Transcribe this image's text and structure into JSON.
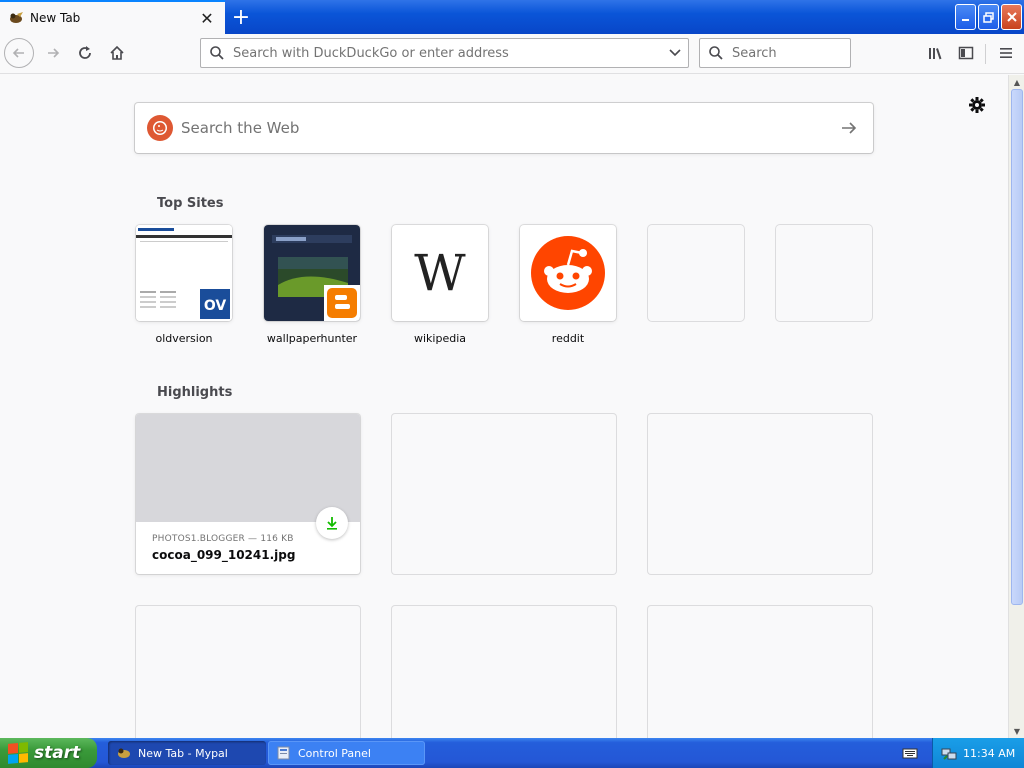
{
  "tab": {
    "title": "New Tab",
    "favicon": "mypal-icon"
  },
  "toolbar": {
    "url_placeholder": "Search with DuckDuckGo or enter address",
    "search_placeholder": "Search"
  },
  "page": {
    "web_search_placeholder": "Search the Web",
    "top_sites_heading": "Top Sites",
    "highlights_heading": "Highlights",
    "top_sites": [
      {
        "label": "oldversion"
      },
      {
        "label": "wallpaperhunter"
      },
      {
        "label": "wikipedia",
        "glyph": "W"
      },
      {
        "label": "reddit"
      },
      {
        "label": ""
      },
      {
        "label": ""
      }
    ],
    "highlights": [
      {
        "source": "PHOTOS1.BLOGGER — 116 KB",
        "title": "cocoa_099_10241.jpg"
      }
    ]
  },
  "taskbar": {
    "start_label": "start",
    "tasks": [
      {
        "label": "New Tab - Mypal",
        "active": true
      },
      {
        "label": "Control Panel",
        "active": false
      }
    ],
    "clock": "11:34 AM"
  },
  "colors": {
    "accent": "#0a84ff",
    "ddg": "#de5833",
    "reddit": "#ff4500",
    "blogger": "#f57d00",
    "download": "#12bc00"
  }
}
